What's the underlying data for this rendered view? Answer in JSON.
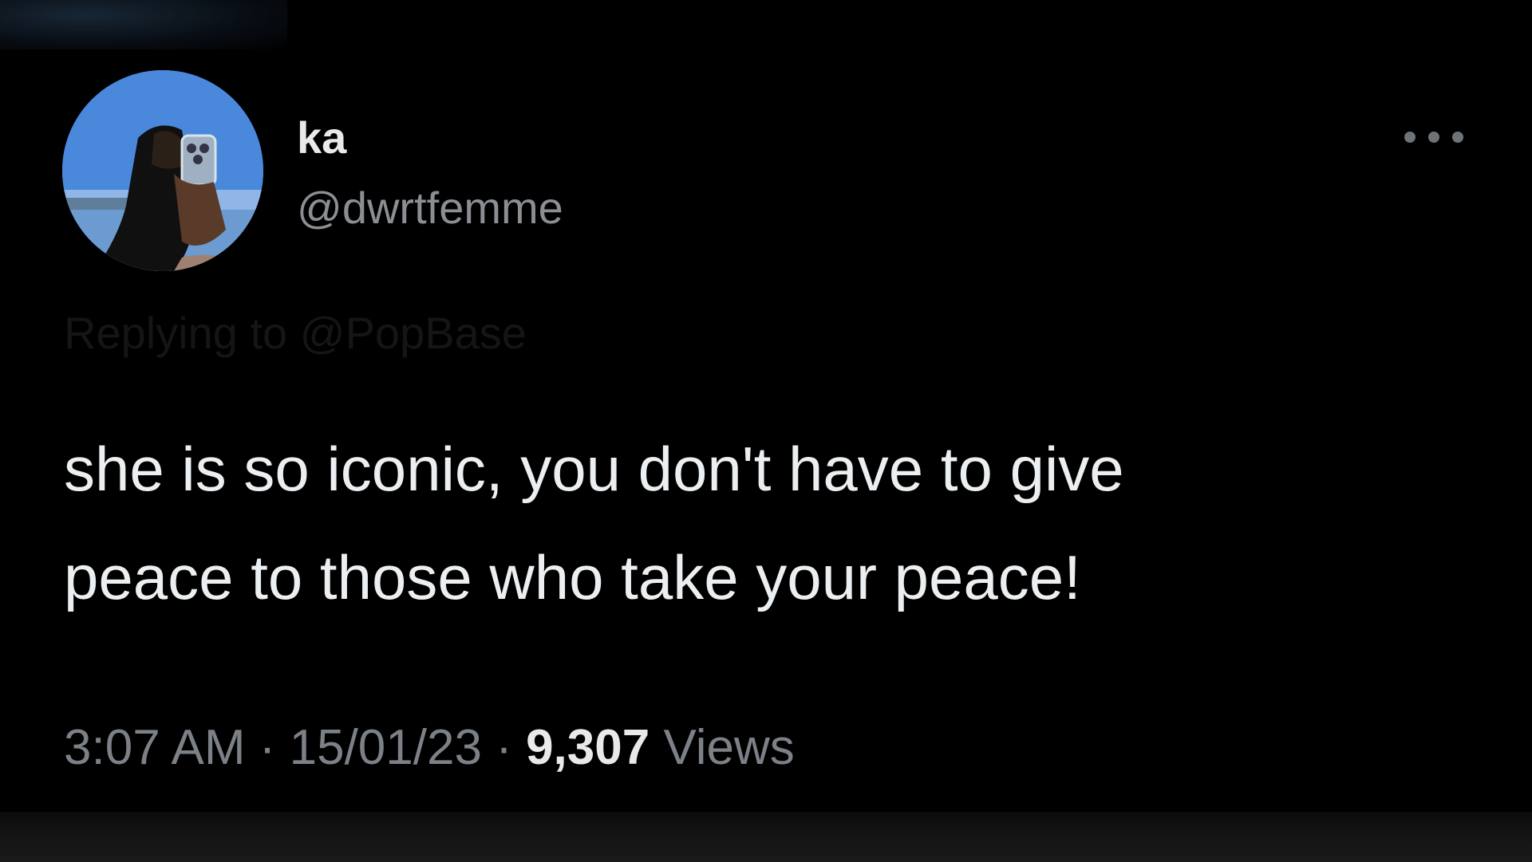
{
  "user": {
    "display_name": "ka",
    "handle": "@dwrtfemme",
    "avatar_icon": "profile-photo"
  },
  "menu": {
    "icon": "more-horizontal-icon"
  },
  "reply": {
    "text": "Replying to @PopBase"
  },
  "tweet": {
    "text": "she is so iconic, you don't have to give\npeace to those who take your peace!"
  },
  "meta": {
    "time": "3:07 AM",
    "separator": "·",
    "date": "15/01/23",
    "views_count": "9,307",
    "views_label": "Views"
  },
  "colors": {
    "background": "#000000",
    "text_primary": "#e7e9ea",
    "text_secondary": "#8b8f94"
  }
}
